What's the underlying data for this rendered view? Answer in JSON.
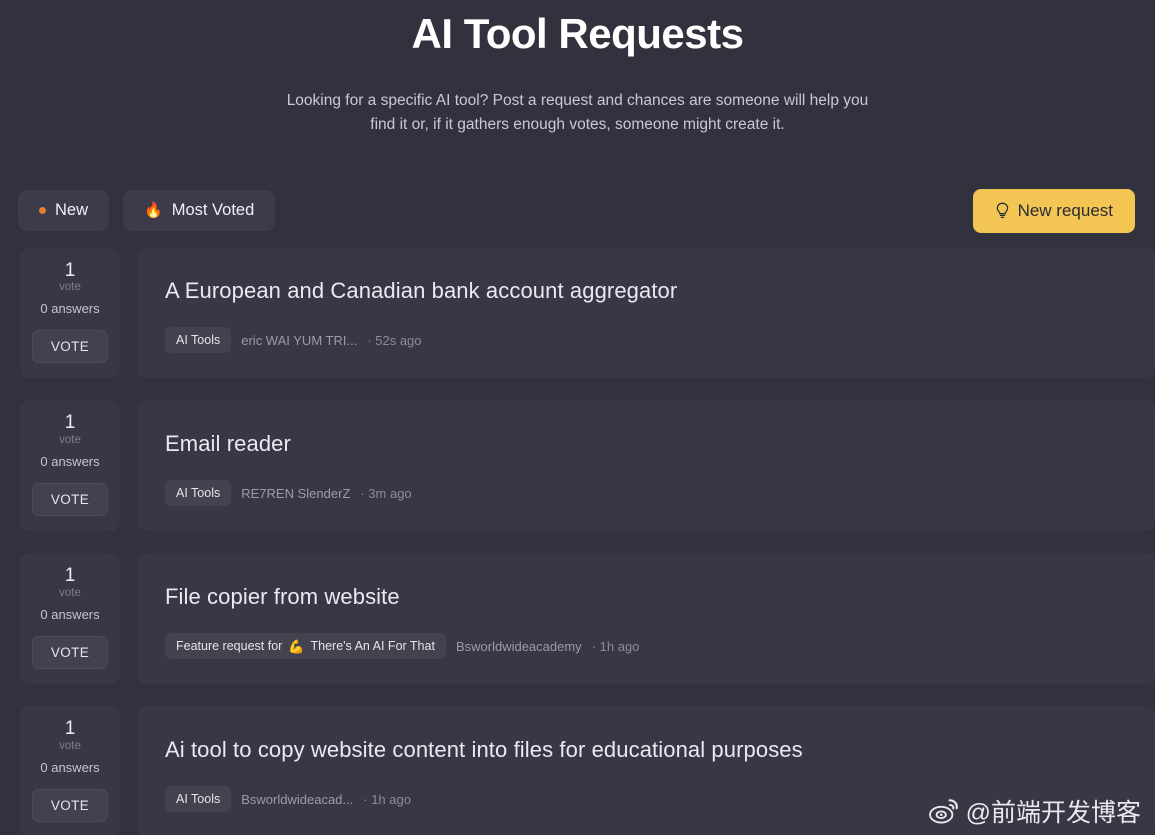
{
  "header": {
    "title": "AI Tool Requests",
    "subtitle": "Looking for a specific AI tool? Post a request and chances are someone will help you find it or, if it gathers enough votes, someone might create it."
  },
  "toolbar": {
    "tabs": [
      {
        "label": "New",
        "icon": "orange-dot-icon",
        "active": true
      },
      {
        "label": "Most Voted",
        "icon": "fire-icon",
        "emoji": "🔥",
        "active": false
      }
    ],
    "new_request": {
      "label": "New request",
      "icon": "lightbulb-icon",
      "color": "#f3c653"
    }
  },
  "colors": {
    "page_background": "#32323f",
    "card_background": "#373746",
    "accent_yellow": "#f3c653",
    "accent_orange": "#e2822f"
  },
  "requests": [
    {
      "votes": "1",
      "votes_label": "vote",
      "answers": "0 answers",
      "vote_button": "VOTE",
      "title": "A European and Canadian bank account aggregator",
      "tag": "AI Tools",
      "tag_emoji": "",
      "tag_prefix": "",
      "author": "eric WAI YUM TRI...",
      "time": "· 52s ago"
    },
    {
      "votes": "1",
      "votes_label": "vote",
      "answers": "0 answers",
      "vote_button": "VOTE",
      "title": "Email reader",
      "tag": "AI Tools",
      "tag_emoji": "",
      "tag_prefix": "",
      "author": "RE7REN SlenderZ",
      "time": "· 3m ago"
    },
    {
      "votes": "1",
      "votes_label": "vote",
      "answers": "0 answers",
      "vote_button": "VOTE",
      "title": "File copier from website",
      "tag": "There's An AI For That",
      "tag_emoji": "💪",
      "tag_prefix": "Feature request for",
      "author": "Bsworldwideacademy",
      "time": "· 1h ago"
    },
    {
      "votes": "1",
      "votes_label": "vote",
      "answers": "0 answers",
      "vote_button": "VOTE",
      "title": "Ai tool to copy website content into files for educational purposes",
      "tag": "AI Tools",
      "tag_emoji": "",
      "tag_prefix": "",
      "author": "Bsworldwideacad...",
      "time": "· 1h ago"
    }
  ],
  "watermark": {
    "text": "@前端开发博客",
    "icon": "weibo-logo-icon"
  }
}
